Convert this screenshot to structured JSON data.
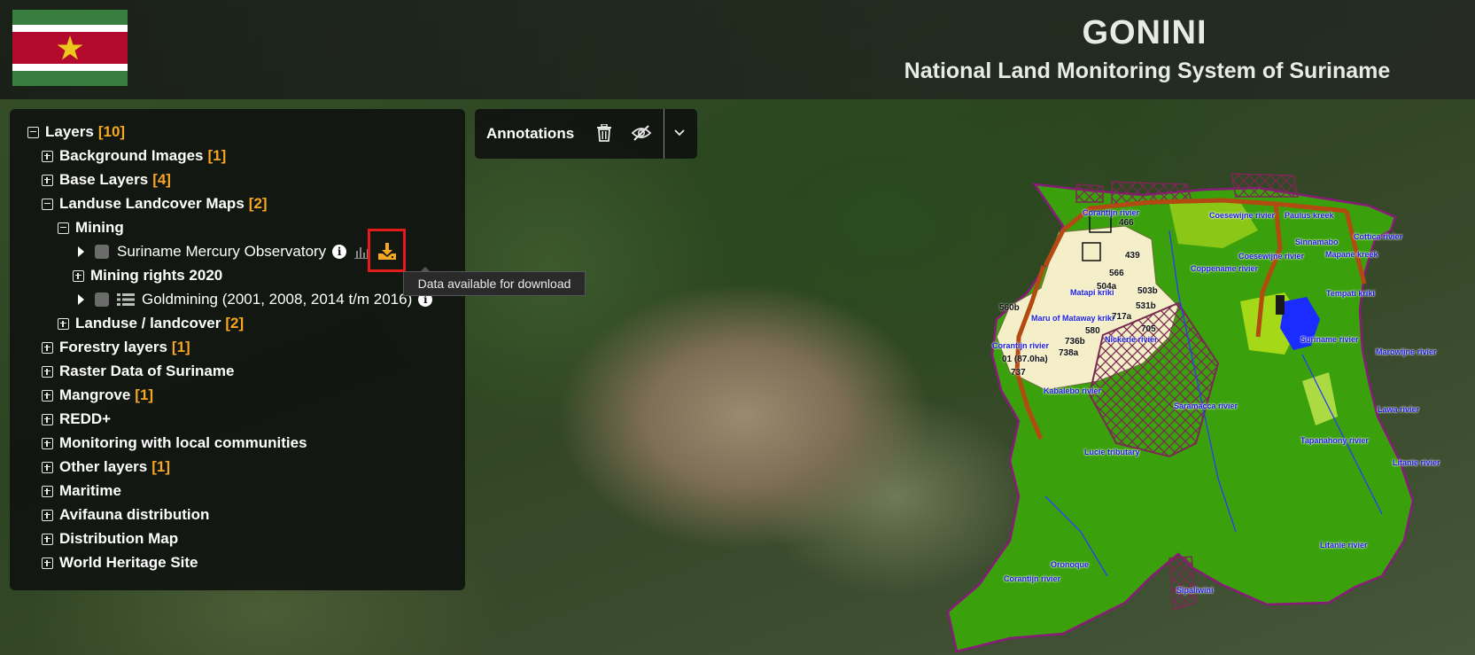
{
  "header": {
    "title": "GONINI",
    "subtitle": "National Land Monitoring System of Suriname"
  },
  "colors": {
    "accent_count": "#f5a623",
    "download_icon": "#f5a623",
    "highlight_box": "#e31b1b",
    "panel_bg": "#101210"
  },
  "layer_tree": {
    "root": {
      "label": "Layers",
      "count": "[10]",
      "expanded": true
    },
    "background_images": {
      "label": "Background Images",
      "count": "[1]"
    },
    "base_layers": {
      "label": "Base Layers",
      "count": "[4]"
    },
    "landuse_maps": {
      "label": "Landuse Landcover Maps",
      "count": "[2]",
      "expanded": true
    },
    "mining": {
      "label": "Mining",
      "expanded": true
    },
    "mercury": {
      "label": "Suriname Mercury Observatory",
      "icons": [
        "info-icon",
        "stats-icon",
        "download-icon"
      ]
    },
    "mining_rights": {
      "label": "Mining rights 2020"
    },
    "goldmining": {
      "label": "Goldmining (2001, 2008, 2014 t/m 2016)",
      "icons": [
        "list-icon",
        "info-icon"
      ]
    },
    "landuse_landcover": {
      "label": "Landuse / landcover",
      "count": "[2]"
    },
    "forestry": {
      "label": "Forestry layers",
      "count": "[1]"
    },
    "raster": {
      "label": "Raster Data of Suriname"
    },
    "mangrove": {
      "label": "Mangrove",
      "count": "[1]"
    },
    "redd": {
      "label": "REDD+"
    },
    "monitoring": {
      "label": "Monitoring with local communities"
    },
    "other_layers": {
      "label": "Other layers",
      "count": "[1]"
    },
    "maritime": {
      "label": "Maritime"
    },
    "avifauna": {
      "label": "Avifauna distribution"
    },
    "distribution_map": {
      "label": "Distribution Map"
    },
    "world_heritage": {
      "label": "World Heritage Site"
    }
  },
  "tooltip": {
    "text": "Data available for download"
  },
  "annotations": {
    "label": "Annotations",
    "icons": [
      "trash-icon",
      "eye-slash-icon",
      "chevron-down-icon"
    ]
  },
  "map_labels": {
    "rivers": [
      "Coesewijne rivier",
      "Paulus kreek",
      "Corantijn rivier",
      "Sinnamabo",
      "Cottica rivier",
      "Coesewijne rivier",
      "Mapane kreek",
      "Coppename rivier",
      "Matapi kriki",
      "Tempati kriki",
      "Maru of Mataway kriki",
      "Nickerie rivier",
      "Corantijn rivier",
      "Suriname rivier",
      "Marowijne rivier",
      "Kabalebo rivier",
      "Saramacca rivier",
      "Lawa rivier",
      "Tapanahony rivier",
      "Lucie tributary",
      "Litanie rivier",
      "Litanie rivier",
      "Oronoque",
      "Corantijn rivier",
      "Sipaliwini"
    ],
    "plots": [
      "466",
      "439",
      "566",
      "504a",
      "503b",
      "531b",
      "560b",
      "580",
      "717a",
      "705",
      "736b",
      "738a",
      "737",
      "01 (87.0ha)"
    ]
  }
}
